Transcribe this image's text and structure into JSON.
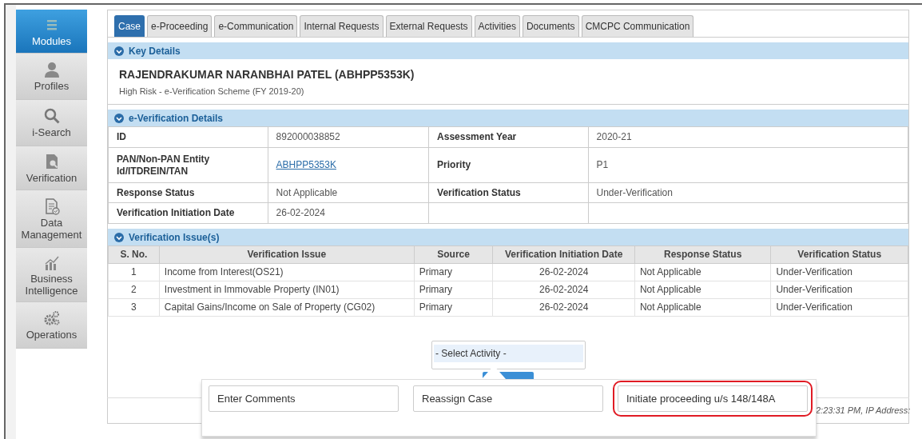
{
  "sidebar": {
    "items": [
      {
        "label": "Modules",
        "selected": true
      },
      {
        "label": "Profiles",
        "selected": false
      },
      {
        "label": "i-Search",
        "selected": false
      },
      {
        "label": "Verification",
        "selected": false
      },
      {
        "label": "Data Management",
        "selected": false
      },
      {
        "label": "Business Intelligence",
        "selected": false
      },
      {
        "label": "Operations",
        "selected": false
      }
    ]
  },
  "tabs": [
    {
      "label": "Case",
      "selected": true
    },
    {
      "label": "e-Proceeding",
      "selected": false
    },
    {
      "label": "e-Communication",
      "selected": false
    },
    {
      "label": "Internal Requests",
      "selected": false
    },
    {
      "label": "External Requests",
      "selected": false
    },
    {
      "label": "Activities",
      "selected": false
    },
    {
      "label": "Documents",
      "selected": false
    },
    {
      "label": "CMCPC Communication",
      "selected": false
    }
  ],
  "key_details": {
    "title": "Key Details",
    "expanded": true,
    "name": "RAJENDRAKUMAR NARANBHAI PATEL  (ABHPP5353K)",
    "subtitle": "High Risk - e-Verification Scheme (FY 2019-20)"
  },
  "e_verification": {
    "title": "e-Verification Details",
    "expanded": true,
    "rows": [
      {
        "fields": [
          {
            "label": "ID",
            "value": "892000038852",
            "kind": "text"
          },
          {
            "label": "Assessment Year",
            "value": "2020-21",
            "kind": "text"
          }
        ]
      },
      {
        "fields": [
          {
            "label": "PAN/Non-PAN Entity Id/ITDREIN/TAN",
            "value": "ABHPP5353K",
            "kind": "link"
          },
          {
            "label": "Priority",
            "value": "P1",
            "kind": "text"
          }
        ]
      },
      {
        "fields": [
          {
            "label": "Response Status",
            "value": "Not Applicable",
            "kind": "text"
          },
          {
            "label": "Verification Status",
            "value": "Under-Verification",
            "kind": "text"
          }
        ]
      },
      {
        "fields": [
          {
            "label": "Verification Initiation Date",
            "value": "26-02-2024",
            "kind": "text"
          }
        ]
      }
    ]
  },
  "issues": {
    "title": "Verification Issue(s)",
    "expanded": true,
    "columns": [
      "S. No.",
      "Verification Issue",
      "Source",
      "Verification Initiation Date",
      "Response Status",
      "Verification Status"
    ],
    "rows": [
      [
        "1",
        "Income from Interest(OS21)",
        "Primary",
        "26-02-2024",
        "Not Applicable",
        "Under-Verification"
      ],
      [
        "2",
        "Investment in Immovable Property (IN01)",
        "Primary",
        "26-02-2024",
        "Not Applicable",
        "Under-Verification"
      ],
      [
        "3",
        "Capital Gains/Income on Sale of Property (CG02)",
        "Primary",
        "26-02-2024",
        "Not Applicable",
        "Under-Verification"
      ]
    ]
  },
  "activity_select": {
    "value": "- Select Activity -"
  },
  "activity_menu": {
    "options": [
      {
        "label": "Enter Comments",
        "highlighted": false
      },
      {
        "label": "Reassign Case",
        "highlighted": false
      },
      {
        "label": "Initiate proceeding u/s 148/148A",
        "highlighted": true
      }
    ]
  },
  "footer": {
    "text": "2:23:31 PM, IP Address:"
  }
}
